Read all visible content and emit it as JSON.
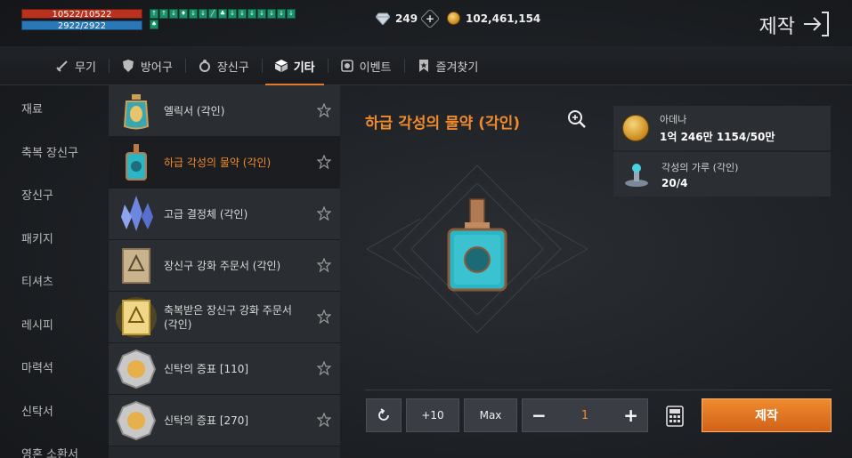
{
  "hud": {
    "hp": "10522/10522",
    "mp": "2922/2922",
    "buffs": [
      "↑",
      "↑",
      "↓",
      "♦",
      "↓",
      "↓",
      "╱",
      "♣",
      "↓",
      "↓",
      "↓",
      "↓",
      "↓",
      "↓",
      "↓",
      "♠"
    ],
    "diamond": "249",
    "adena": "102,461,154",
    "page_title": "제작"
  },
  "tabs": [
    {
      "label": "무기",
      "icon": "sword-icon"
    },
    {
      "label": "방어구",
      "icon": "shield-icon"
    },
    {
      "label": "장신구",
      "icon": "ring-icon"
    },
    {
      "label": "기타",
      "icon": "cube-icon",
      "active": true
    },
    {
      "label": "이벤트",
      "icon": "event-icon"
    },
    {
      "label": "즐겨찾기",
      "icon": "bookmark-icon"
    }
  ],
  "categories": [
    "재료",
    "축복 장신구",
    "장신구",
    "패키지",
    "티셔츠",
    "레시피",
    "마력석",
    "신탁서",
    "영혼 소환서"
  ],
  "items": [
    {
      "name": "엘릭서 (각인)",
      "icon": "elixir-icon"
    },
    {
      "name": "하급 각성의 물약 (각인)",
      "icon": "potion-icon",
      "selected": true
    },
    {
      "name": "고급 결정체 (각인)",
      "icon": "crystal-icon"
    },
    {
      "name": "장신구 강화 주문서 (각인)",
      "icon": "scroll-icon"
    },
    {
      "name": "축복받은 장신구 강화 주문서 (각인)",
      "icon": "blessed-scroll-icon"
    },
    {
      "name": "신탁의 증표 [110]",
      "icon": "token-icon"
    },
    {
      "name": "신탁의 증표 [270]",
      "icon": "token-icon"
    }
  ],
  "detail": {
    "title": "하급 각성의 물약 (각인)",
    "materials": [
      {
        "name": "아데나",
        "qty": "1억 246만 1154/50만",
        "icon": "adena-coin-icon"
      },
      {
        "name": "각성의 가루 (각인)",
        "qty": "20/4",
        "icon": "powder-icon"
      }
    ],
    "controls": {
      "plus10": "+10",
      "max": "Max",
      "quantity": "1",
      "minus": "−",
      "plus": "+"
    },
    "craft_label": "제작"
  },
  "colors": {
    "accent": "#f08a2c",
    "hp": "#b8321f",
    "mp": "#2b78b8"
  }
}
